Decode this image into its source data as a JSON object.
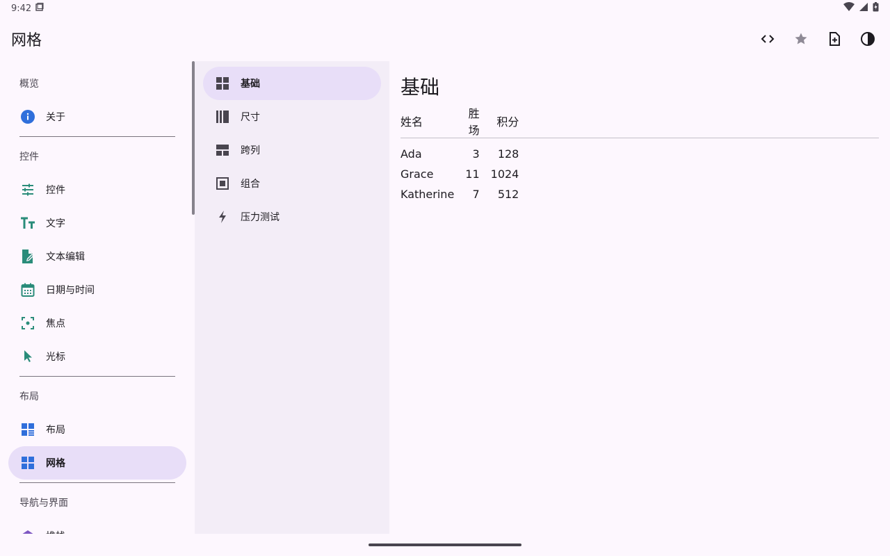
{
  "status": {
    "time": "9:42"
  },
  "app_bar": {
    "title": "网格"
  },
  "nav": {
    "sections": [
      {
        "title": "概览",
        "items": [
          {
            "label": "关于",
            "icon": "info-icon"
          }
        ]
      },
      {
        "title": "控件",
        "items": [
          {
            "label": "控件",
            "icon": "sliders-icon"
          },
          {
            "label": "文字",
            "icon": "text-fields-icon"
          },
          {
            "label": "文本编辑",
            "icon": "edit-document-icon"
          },
          {
            "label": "日期与时间",
            "icon": "calendar-icon"
          },
          {
            "label": "焦点",
            "icon": "focus-icon"
          },
          {
            "label": "光标",
            "icon": "cursor-icon"
          }
        ]
      },
      {
        "title": "布局",
        "items": [
          {
            "label": "布局",
            "icon": "layout-icon"
          },
          {
            "label": "网格",
            "icon": "grid-icon"
          }
        ]
      },
      {
        "title": "导航与界面",
        "items": [
          {
            "label": "堆栈",
            "icon": "stack-icon"
          }
        ]
      }
    ]
  },
  "subnav": {
    "items": [
      {
        "label": "基础",
        "icon": "grid-icon"
      },
      {
        "label": "尺寸",
        "icon": "columns-icon"
      },
      {
        "label": "跨列",
        "icon": "span-icon"
      },
      {
        "label": "组合",
        "icon": "composite-icon"
      },
      {
        "label": "压力测试",
        "icon": "bolt-icon"
      }
    ]
  },
  "content": {
    "title": "基础",
    "table": {
      "headers": [
        "姓名",
        "胜场",
        "积分"
      ],
      "rows": [
        [
          "Ada",
          "3",
          "128"
        ],
        [
          "Grace",
          "11",
          "1024"
        ],
        [
          "Katherine",
          "7",
          "512"
        ]
      ]
    }
  },
  "colors": {
    "accent_teal": "#2a8c7a",
    "accent_blue": "#2f6fdb",
    "active_bg": "#e8def8",
    "subnav_bg": "#f3edf7"
  }
}
